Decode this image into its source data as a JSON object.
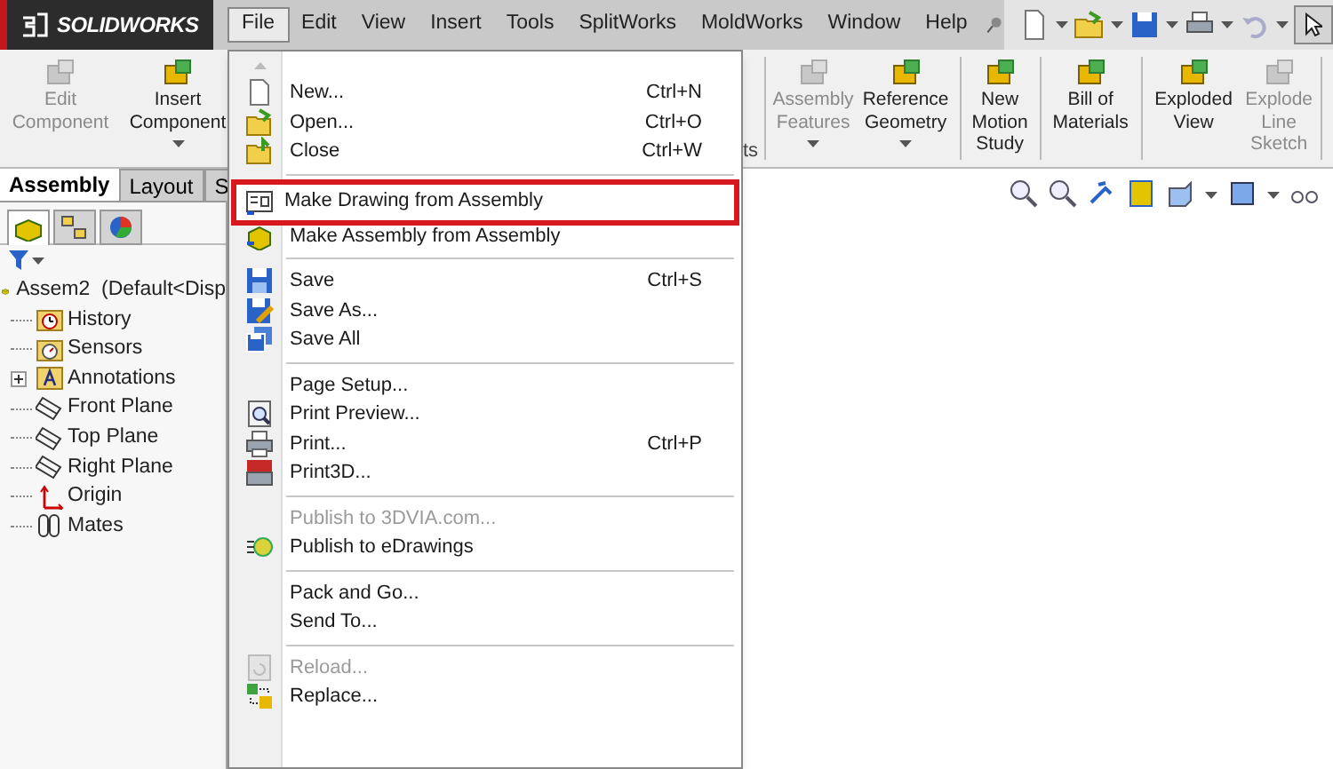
{
  "app": {
    "logo": "SOLIDWORKS"
  },
  "menu_bar": [
    {
      "label": "File",
      "selected": true
    },
    {
      "label": "Edit",
      "selected": false
    },
    {
      "label": "View",
      "selected": false
    },
    {
      "label": "Insert",
      "selected": false
    },
    {
      "label": "Tools",
      "selected": false
    },
    {
      "label": "SplitWorks",
      "selected": false
    },
    {
      "label": "MoldWorks",
      "selected": false
    },
    {
      "label": "Window",
      "selected": false
    },
    {
      "label": "Help",
      "selected": false
    }
  ],
  "ribbon_left": [
    {
      "label": "Edit\nComponent",
      "disabled": true,
      "dropdown": false
    },
    {
      "label": "Insert\nComponent",
      "disabled": false,
      "dropdown": true
    }
  ],
  "ribbon_cut_text": "ts",
  "ribbon_right": [
    {
      "label": "Assembly\nFeatures",
      "disabled": true,
      "dropdown": true
    },
    {
      "label": "Reference\nGeometry",
      "disabled": false,
      "dropdown": true
    },
    {
      "label": "New\nMotion\nStudy",
      "disabled": false,
      "dropdown": false
    },
    {
      "label": "Bill of\nMaterials",
      "disabled": false,
      "dropdown": false
    },
    {
      "label": "Exploded\nView",
      "disabled": false,
      "dropdown": false
    },
    {
      "label": "Explode\nLine\nSketch",
      "disabled": true,
      "dropdown": false
    }
  ],
  "tabs": [
    {
      "label": "Assembly",
      "selected": true
    },
    {
      "label": "Layout",
      "selected": false
    },
    {
      "label": "S",
      "selected": false
    }
  ],
  "panel_tabs": [
    {
      "selected": true
    },
    {
      "selected": false
    },
    {
      "selected": false
    }
  ],
  "tree": {
    "label": "Assem2  (Default<Disp",
    "kind": "assembly",
    "children": [
      {
        "label": "History",
        "kind": "history"
      },
      {
        "label": "Sensors",
        "kind": "sensors"
      },
      {
        "label": "Annotations",
        "kind": "annotations",
        "expanded": false
      },
      {
        "label": "Front Plane",
        "kind": "plane"
      },
      {
        "label": "Top Plane",
        "kind": "plane"
      },
      {
        "label": "Right Plane",
        "kind": "plane"
      },
      {
        "label": "Origin",
        "kind": "origin"
      },
      {
        "label": "Mates",
        "kind": "mates"
      }
    ]
  },
  "file_menu": {
    "groups": [
      [
        {
          "label": "New...",
          "shortcut": "Ctrl+N",
          "kind": "new",
          "disabled": false,
          "highlighted": false
        },
        {
          "label": "Open...",
          "shortcut": "Ctrl+O",
          "kind": "open",
          "disabled": false,
          "highlighted": false
        },
        {
          "label": "Close",
          "shortcut": "Ctrl+W",
          "kind": "close",
          "disabled": false,
          "highlighted": false
        }
      ],
      [
        {
          "label": "Make Drawing from Assembly",
          "kind": "drawing",
          "disabled": false,
          "highlighted": true
        },
        {
          "label": "Make Assembly from Assembly",
          "kind": "assembly",
          "disabled": false,
          "highlighted": false
        }
      ],
      [
        {
          "label": "Save",
          "shortcut": "Ctrl+S",
          "kind": "save",
          "disabled": false,
          "highlighted": false
        },
        {
          "label": "Save As...",
          "kind": "saveas",
          "disabled": false,
          "highlighted": false
        },
        {
          "label": "Save All",
          "kind": "saveall",
          "disabled": false,
          "highlighted": false
        }
      ],
      [
        {
          "label": "Page Setup...",
          "kind": "none",
          "disabled": false,
          "highlighted": false
        },
        {
          "label": "Print Preview...",
          "kind": "preview",
          "disabled": false,
          "highlighted": false
        },
        {
          "label": "Print...",
          "shortcut": "Ctrl+P",
          "kind": "print",
          "disabled": false,
          "highlighted": false
        },
        {
          "label": "Print3D...",
          "kind": "print3d",
          "disabled": false,
          "highlighted": false
        }
      ],
      [
        {
          "label": "Publish to 3DVIA.com...",
          "kind": "none",
          "disabled": true,
          "highlighted": false
        },
        {
          "label": "Publish to eDrawings",
          "kind": "edrawings",
          "disabled": false,
          "highlighted": false
        }
      ],
      [
        {
          "label": "Pack and Go...",
          "kind": "none",
          "disabled": false,
          "highlighted": false
        },
        {
          "label": "Send To...",
          "kind": "none",
          "disabled": false,
          "highlighted": false
        }
      ],
      [
        {
          "label": "Reload...",
          "kind": "reload",
          "disabled": true,
          "highlighted": false
        },
        {
          "label": "Replace...",
          "kind": "replace",
          "disabled": false,
          "highlighted": false
        }
      ]
    ]
  }
}
